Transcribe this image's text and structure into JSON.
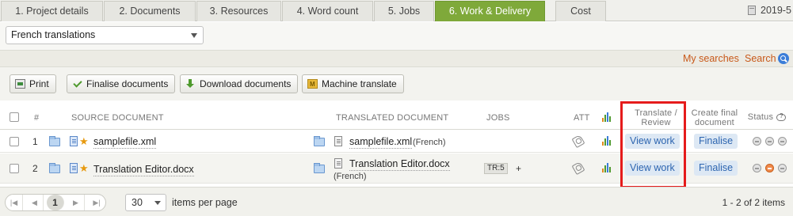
{
  "tabs": [
    {
      "label": "1. Project details",
      "active": false
    },
    {
      "label": "2. Documents",
      "active": false
    },
    {
      "label": "3. Resources",
      "active": false
    },
    {
      "label": "4. Word count",
      "active": false
    },
    {
      "label": "5. Jobs",
      "active": false
    },
    {
      "label": "6. Work & Delivery",
      "active": true
    },
    {
      "label": "Cost",
      "active": false
    }
  ],
  "tabbar_date": "2019-5",
  "filter": {
    "selected": "French translations"
  },
  "search_bar": {
    "my_searches": "My searches",
    "search": "Search"
  },
  "toolbar": {
    "print": "Print",
    "finalise": "Finalise documents",
    "download": "Download documents",
    "machine_translate": "Machine translate"
  },
  "table": {
    "headers": {
      "num": "#",
      "source": "SOURCE DOCUMENT",
      "translated": "TRANSLATED DOCUMENT",
      "jobs": "JOBS",
      "att": "ATT",
      "translate_review": "Translate / Review",
      "create_final": "Create final document",
      "status": "Status"
    },
    "rows": [
      {
        "num": "1",
        "source_file": "samplefile.xml",
        "translated_file": "samplefile.xml",
        "translated_lang": "(French)",
        "job_tag": "",
        "job_plus": "",
        "view_label": "View work",
        "finalise_label": "Finalise",
        "status": [
          "grey",
          "grey",
          "grey"
        ]
      },
      {
        "num": "2",
        "source_file": "Translation Editor.docx",
        "translated_file": "Translation Editor.docx",
        "translated_lang": "(French)",
        "job_tag": "TR:5",
        "job_plus": "+",
        "view_label": "View work",
        "finalise_label": "Finalise",
        "status": [
          "grey",
          "orange",
          "grey"
        ]
      }
    ]
  },
  "footer": {
    "current_page": "1",
    "per_page": "30",
    "per_page_label": "items per page",
    "range": "1 - 2 of 2 items"
  },
  "colors": {
    "active_tab": "#7fa93a",
    "link": "#2d65b0",
    "search_link": "#c8591a",
    "highlight": "#e51b1b"
  }
}
